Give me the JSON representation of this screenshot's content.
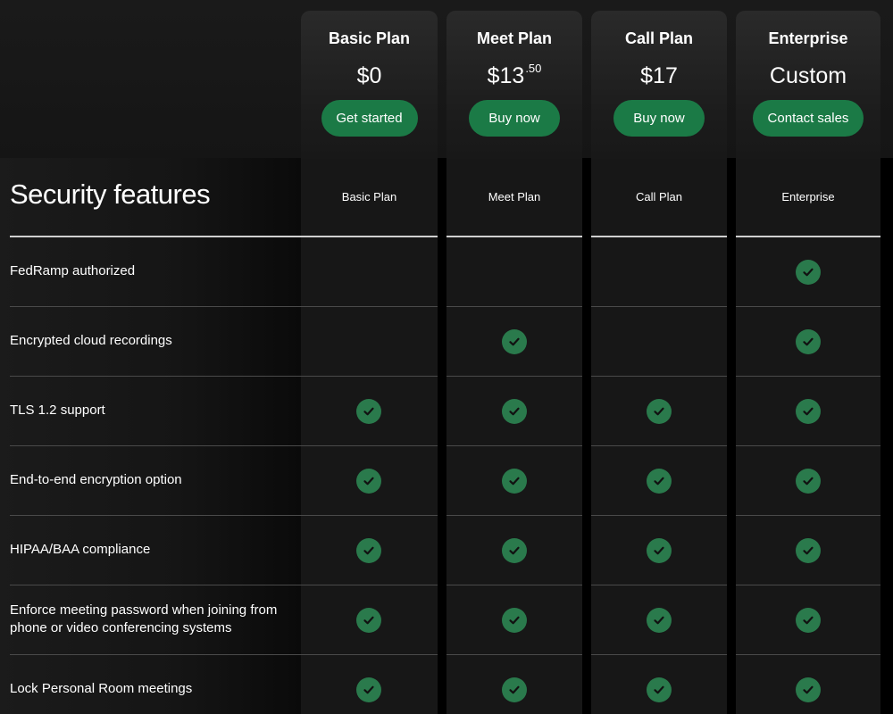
{
  "plans": [
    {
      "name": "Basic Plan",
      "price": "$0",
      "price_cents": "",
      "cta": "Get started"
    },
    {
      "name": "Meet Plan",
      "price": "$13",
      "price_cents": ".50",
      "cta": "Buy now"
    },
    {
      "name": "Call Plan",
      "price": "$17",
      "price_cents": "",
      "cta": "Buy now"
    },
    {
      "name": "Enterprise",
      "price": "Custom",
      "price_cents": "",
      "cta": "Contact sales"
    }
  ],
  "table": {
    "title": "Security features",
    "columns": [
      "Basic Plan",
      "Meet Plan",
      "Call Plan",
      "Enterprise"
    ],
    "rows": [
      {
        "label": "FedRamp authorized",
        "checks": [
          false,
          false,
          false,
          true
        ]
      },
      {
        "label": "Encrypted cloud recordings",
        "checks": [
          false,
          true,
          false,
          true
        ]
      },
      {
        "label": "TLS 1.2 support",
        "checks": [
          true,
          true,
          true,
          true
        ]
      },
      {
        "label": "End-to-end encryption option",
        "checks": [
          true,
          true,
          true,
          true
        ]
      },
      {
        "label": "HIPAA/BAA compliance",
        "checks": [
          true,
          true,
          true,
          true
        ]
      },
      {
        "label": "Enforce meeting password when joining from phone or video conferencing systems",
        "checks": [
          true,
          true,
          true,
          true
        ]
      },
      {
        "label": "Lock Personal Room meetings",
        "checks": [
          true,
          true,
          true,
          true
        ]
      }
    ]
  },
  "icons": {
    "check": "check-circle-icon"
  },
  "colors": {
    "accent": "#1b7a46",
    "check_bg": "#2a7a4c",
    "background": "#000000"
  }
}
